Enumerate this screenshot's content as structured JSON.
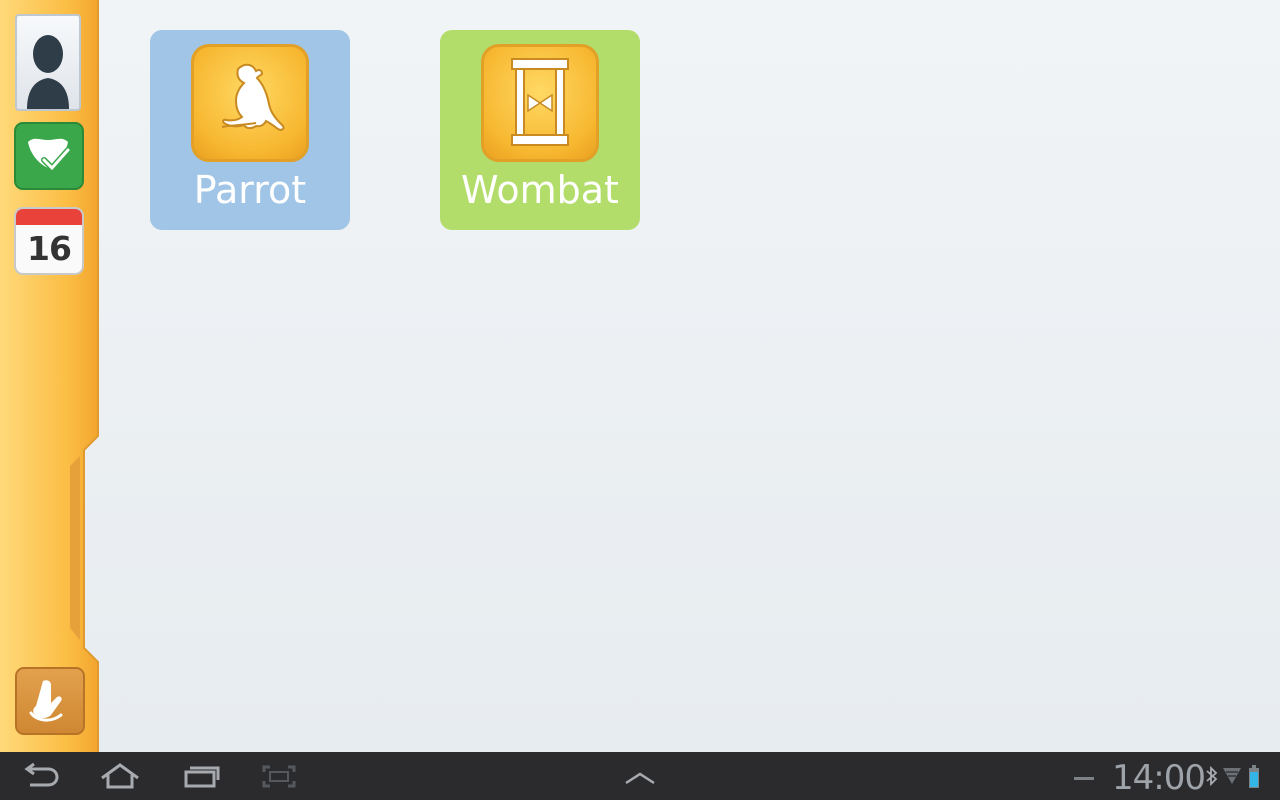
{
  "apps": [
    {
      "label": "Parrot",
      "icon": "parrot-icon",
      "color": "#a0c5e7"
    },
    {
      "label": "Wombat",
      "icon": "hourglass-icon",
      "color": "#b2dd6b"
    }
  ],
  "sidebar": {
    "profile_icon": "profile-silhouette-icon",
    "checklist_icon": "checklist-icon",
    "calendar_day": "16",
    "bottom_icon": "hand-icon",
    "color": "#fbbd44"
  },
  "navbar": {
    "back_icon": "back-icon",
    "home_icon": "home-icon",
    "recent_icon": "recent-apps-icon",
    "screenshot_icon": "screenshot-icon",
    "up_icon": "chevron-up-icon",
    "minimize_icon": "minus-icon",
    "clock": "14:00",
    "bluetooth_icon": "bluetooth-icon",
    "wifi_icon": "wifi-icon",
    "battery_icon": "battery-icon"
  }
}
